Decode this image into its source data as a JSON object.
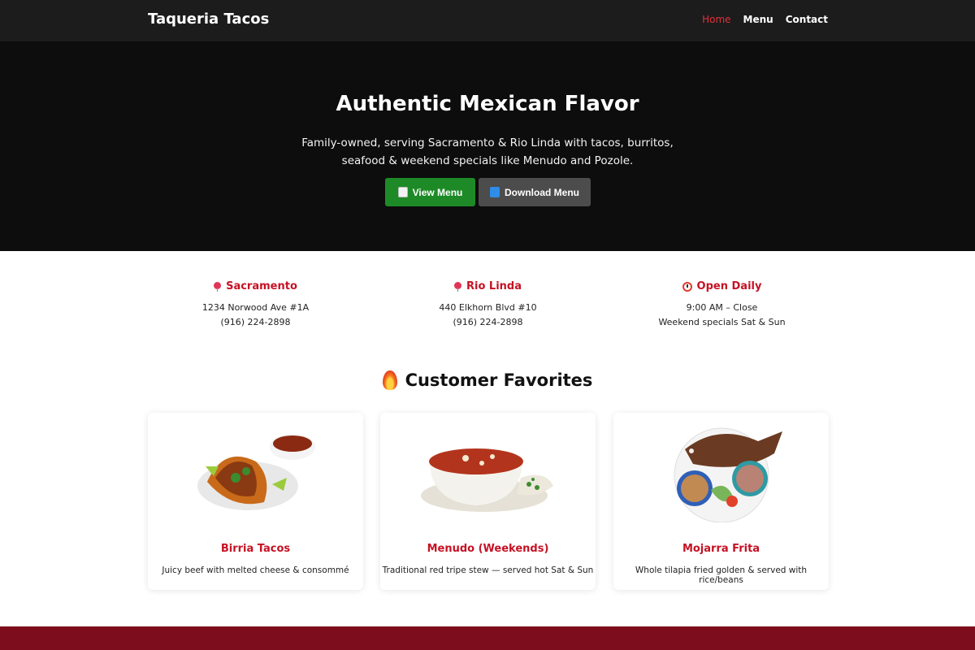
{
  "brand": "Taqueria Tacos",
  "nav": {
    "home": "Home",
    "menu": "Menu",
    "contact": "Contact"
  },
  "hero": {
    "title": "Authentic Mexican Flavor",
    "subtitle": "Family-owned, serving Sacramento & Rio Linda with tacos, burritos, seafood & weekend specials like Menudo and Pozole.",
    "view_menu": "View Menu",
    "download_menu": "Download Menu"
  },
  "info": [
    {
      "title": "Sacramento",
      "line1": "1234 Norwood Ave #1A",
      "line2": "(916) 224-2898",
      "icon": "pin-icon"
    },
    {
      "title": "Rio Linda",
      "line1": "440 Elkhorn Blvd #10",
      "line2": "(916) 224-2898",
      "icon": "pin-icon"
    },
    {
      "title": "Open Daily",
      "line1": "9:00 AM – Close",
      "line2": "Weekend specials Sat & Sun",
      "icon": "clock-icon"
    }
  ],
  "favorites": {
    "title": "Customer Favorites",
    "items": [
      {
        "name": "Birria Tacos",
        "desc": "Juicy beef with melted cheese & consommé"
      },
      {
        "name": "Menudo (Weekends)",
        "desc": "Traditional red tripe stew — served hot Sat & Sun"
      },
      {
        "name": "Mojarra Frita",
        "desc": "Whole tilapia fried golden & served with rice/beans"
      }
    ]
  },
  "colors": {
    "accent_red": "#c61224",
    "nav_bg": "#1c1c1c",
    "hero_bg": "#0d0d0d",
    "btn_green": "#1e8a27",
    "btn_gray": "#4c4c4c",
    "footer": "#7d0d1c"
  }
}
